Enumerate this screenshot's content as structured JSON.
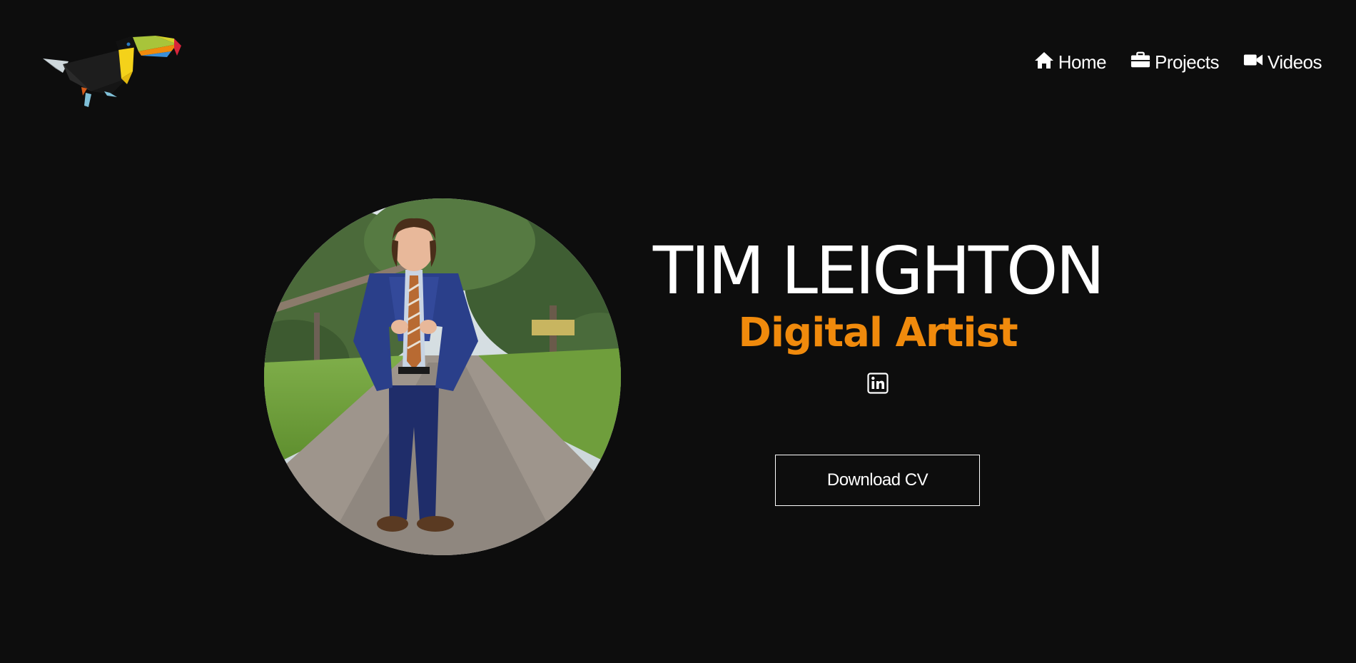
{
  "nav": {
    "items": [
      {
        "label": "Home",
        "icon": "home-icon"
      },
      {
        "label": "Projects",
        "icon": "briefcase-icon"
      },
      {
        "label": "Videos",
        "icon": "video-camera-icon"
      }
    ]
  },
  "logo": {
    "icon": "toucan-logo"
  },
  "hero": {
    "name": "TIM LEIGHTON",
    "role": "Digital Artist",
    "social_icon": "linkedin-icon",
    "cta_label": "Download CV"
  },
  "colors": {
    "background": "#0d0d0d",
    "accent": "#f08a0c",
    "text": "#ffffff"
  }
}
